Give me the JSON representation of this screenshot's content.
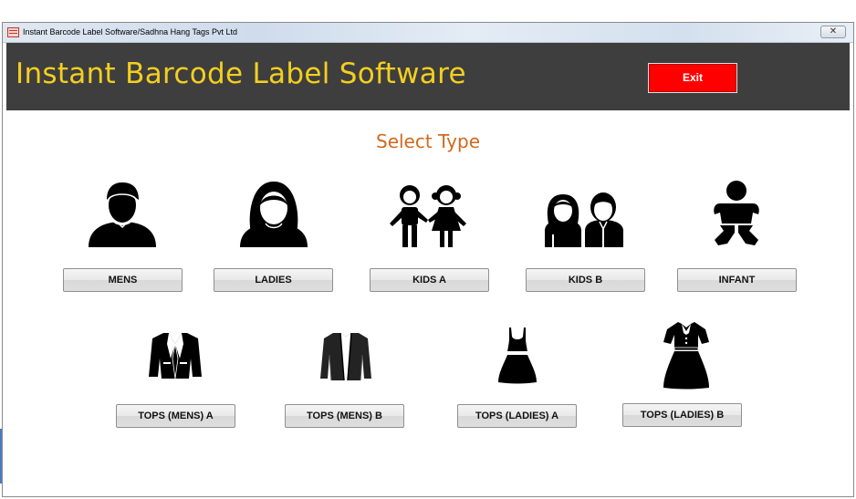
{
  "window": {
    "title": "Instant Barcode Label Software/Sadhna Hang Tags Pvt Ltd",
    "close_glyph": "✕"
  },
  "header": {
    "app_title": "Instant Barcode Label Software",
    "exit_label": "Exit",
    "background_color": "#3e3e3e",
    "title_color": "#f3cf1f",
    "exit_color": "#ff0000"
  },
  "main": {
    "section_title": "Select Type",
    "section_title_color": "#d0691e",
    "row1": [
      {
        "label": "MENS",
        "icon": "man-icon"
      },
      {
        "label": "LADIES",
        "icon": "woman-icon"
      },
      {
        "label": "KIDS  A",
        "icon": "kids-holding-hands-icon"
      },
      {
        "label": "KIDS  B",
        "icon": "kids-pair-icon"
      },
      {
        "label": "INFANT",
        "icon": "baby-icon"
      }
    ],
    "row2": [
      {
        "label": "TOPS (MENS) A",
        "icon": "blazer-icon"
      },
      {
        "label": "TOPS (MENS) B",
        "icon": "cardigan-icon"
      },
      {
        "label": "TOPS (LADIES) A",
        "icon": "dress-icon"
      },
      {
        "label": "TOPS (LADIES) B",
        "icon": "collared-dress-icon"
      }
    ]
  }
}
